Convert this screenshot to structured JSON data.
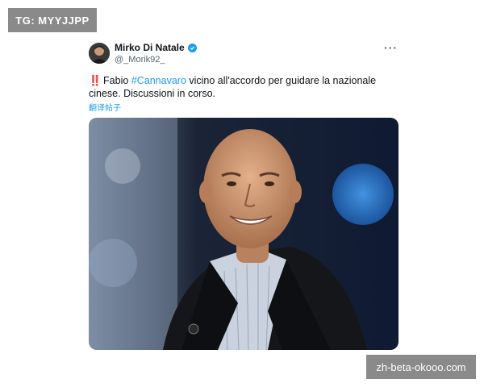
{
  "watermark_top_left": "TG: MYYJJPP",
  "watermark_bottom_right": "zh-beta-okooo.com",
  "tweet": {
    "author_name": "Mirko Di Natale",
    "handle": "@_Morik92_",
    "verified_icon": "verified-badge-icon",
    "more_icon": "more-options-icon",
    "text_emphasis": "‼️",
    "text_before_hashtag": " Fabio ",
    "hashtag": "#Cannavaro",
    "text_after_hashtag": " vicino all'accordo per guidare la nazionale cinese. Discussioni in corso.",
    "translate_label": "翻译帖子",
    "photo_description_icon": "portrait-photo"
  },
  "colors": {
    "link": "#1d9bf0",
    "watermark_bg": "#8a8a8a",
    "emphasis": "#e0245e"
  }
}
